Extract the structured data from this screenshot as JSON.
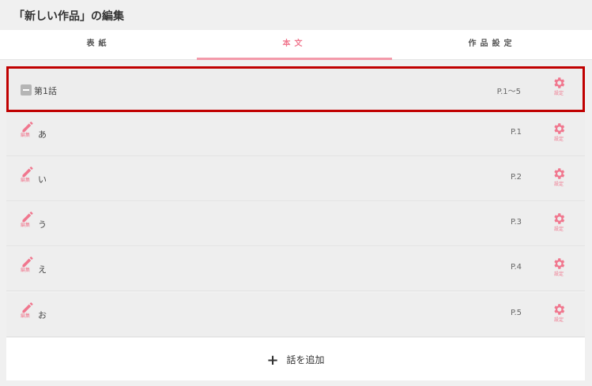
{
  "header": {
    "title": "「新しい作品」の編集"
  },
  "tabs": [
    {
      "label": "表紙",
      "active": false
    },
    {
      "label": "本文",
      "active": true
    },
    {
      "label": "作品設定",
      "active": false
    }
  ],
  "chapter": {
    "label": "第1話",
    "pages": "P.1〜5",
    "settings_label": "設定"
  },
  "episodes": [
    {
      "title": "あ",
      "page": "P.1",
      "edit_label": "編集",
      "settings_label": "設定"
    },
    {
      "title": "い",
      "page": "P.2",
      "edit_label": "編集",
      "settings_label": "設定"
    },
    {
      "title": "う",
      "page": "P.3",
      "edit_label": "編集",
      "settings_label": "設定"
    },
    {
      "title": "え",
      "page": "P.4",
      "edit_label": "編集",
      "settings_label": "設定"
    },
    {
      "title": "お",
      "page": "P.5",
      "edit_label": "編集",
      "settings_label": "設定"
    }
  ],
  "add_button": {
    "label": "話を追加",
    "icon": "plus-icon"
  },
  "colors": {
    "accent": "#f0778e",
    "highlight_border": "#c00000"
  }
}
